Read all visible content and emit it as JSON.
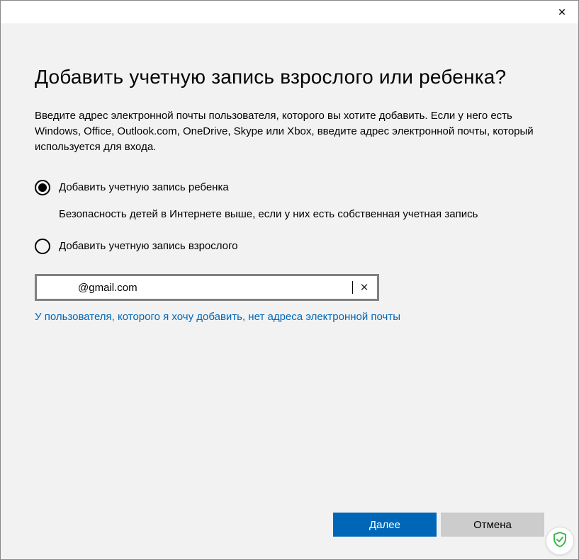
{
  "window": {
    "close_icon": "✕"
  },
  "dialog": {
    "title": "Добавить учетную запись взрослого или ребенка?",
    "description": "Введите адрес электронной почты пользователя, которого вы хотите добавить. Если у него есть Windows, Office, Outlook.com, OneDrive, Skype или Xbox, введите адрес электронной почты, который используется для входа.",
    "options": [
      {
        "label": "Добавить учетную запись ребенка",
        "hint": "Безопасность детей в Интернете выше, если у них есть собственная учетная запись",
        "selected": true
      },
      {
        "label": "Добавить учетную запись взрослого",
        "hint": "",
        "selected": false
      }
    ],
    "email_value": "@gmail.com",
    "clear_icon": "✕",
    "no_email_link": "У пользователя, которого я хочу добавить, нет адреса электронной почты"
  },
  "footer": {
    "next_label": "Далее",
    "cancel_label": "Отмена"
  }
}
